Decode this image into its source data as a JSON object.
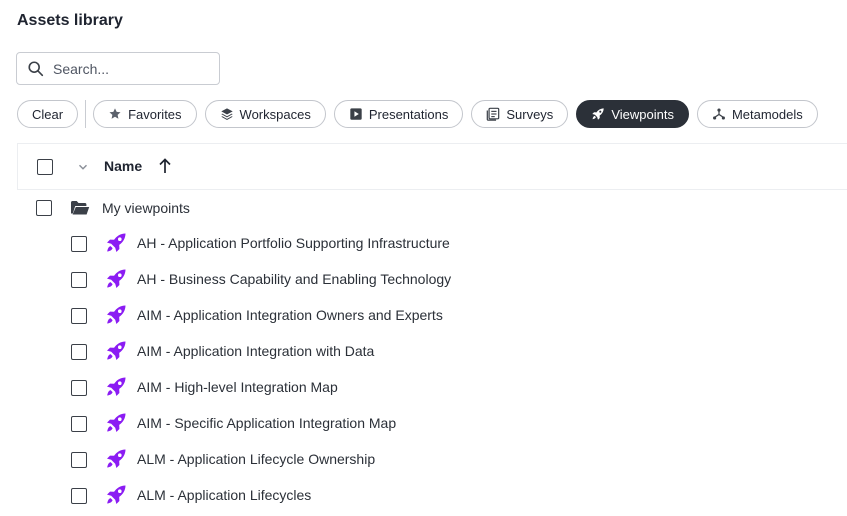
{
  "page": {
    "title": "Assets library"
  },
  "search": {
    "placeholder": "Search..."
  },
  "filters": {
    "clear": "Clear",
    "chips": [
      {
        "label": "Favorites",
        "icon": "star-icon",
        "active": false
      },
      {
        "label": "Workspaces",
        "icon": "layers-icon",
        "active": false
      },
      {
        "label": "Presentations",
        "icon": "presentation-icon",
        "active": false
      },
      {
        "label": "Surveys",
        "icon": "survey-icon",
        "active": false
      },
      {
        "label": "Viewpoints",
        "icon": "rocket-icon",
        "active": true
      },
      {
        "label": "Metamodels",
        "icon": "metamodel-icon",
        "active": false
      }
    ]
  },
  "list": {
    "column_name": "Name",
    "sort": "ascending",
    "folder": {
      "label": "My viewpoints"
    },
    "items": [
      "AH - Application Portfolio Supporting Infrastructure",
      "AH - Business Capability and Enabling Technology",
      "AIM - Application Integration Owners and Experts",
      "AIM - Application Integration with Data",
      "AIM - High-level Integration Map",
      "AIM - Specific Application Integration Map",
      "ALM - Application Lifecycle Ownership",
      "ALM - Application Lifecycles"
    ]
  },
  "colors": {
    "accent": "#8b1cf3",
    "active_chip": "#2b3038"
  }
}
